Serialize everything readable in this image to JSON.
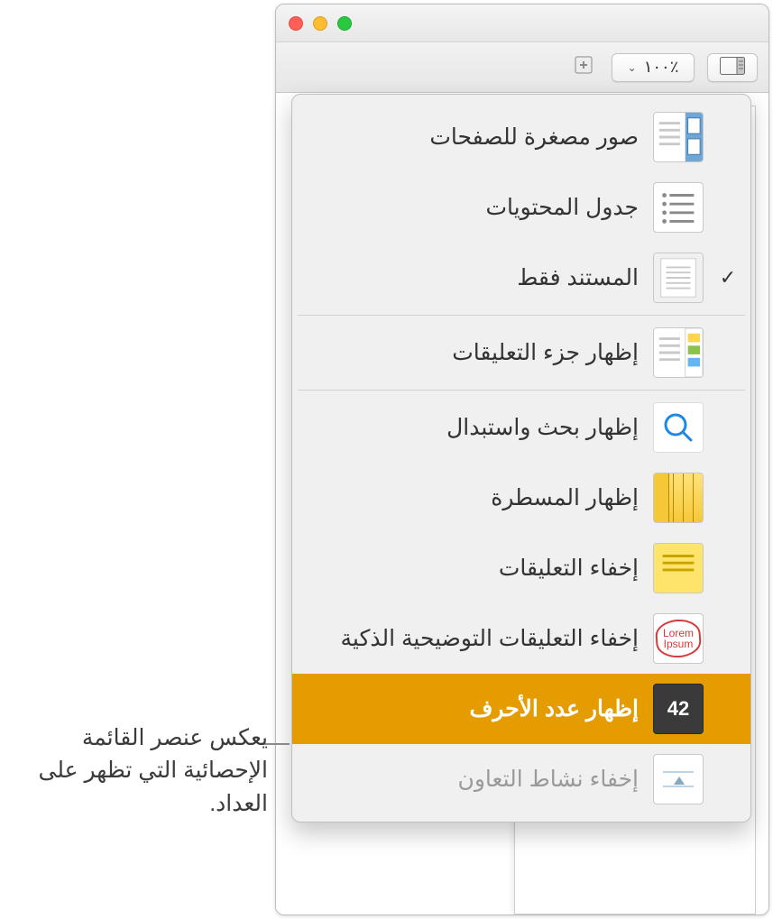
{
  "window": {
    "zoom_label": "٪١٠٠"
  },
  "menu": {
    "items": [
      {
        "id": "thumbnails",
        "label": "صور مصغرة للصفحات",
        "checked": false,
        "disabled": false
      },
      {
        "id": "toc",
        "label": "جدول المحتويات",
        "checked": false,
        "disabled": false
      },
      {
        "id": "doc-only",
        "label": "المستند فقط",
        "checked": true,
        "disabled": false
      },
      {
        "sep": true
      },
      {
        "id": "comments-pane",
        "label": "إظهار جزء التعليقات",
        "checked": false,
        "disabled": false
      },
      {
        "sep": true
      },
      {
        "id": "find",
        "label": "إظهار بحث واستبدال",
        "checked": false,
        "disabled": false
      },
      {
        "id": "ruler",
        "label": "إظهار المسطرة",
        "checked": false,
        "disabled": false
      },
      {
        "id": "hide-comments",
        "label": "إخفاء التعليقات",
        "checked": false,
        "disabled": false
      },
      {
        "id": "smart-annot",
        "label": "إخفاء التعليقات التوضيحية الذكية",
        "checked": false,
        "disabled": false
      },
      {
        "id": "char-count",
        "label": "إظهار عدد الأحرف",
        "checked": false,
        "disabled": false,
        "selected": true,
        "count_badge": "42"
      },
      {
        "id": "collab",
        "label": "إخفاء نشاط التعاون",
        "checked": false,
        "disabled": true
      }
    ]
  },
  "callout": {
    "text": "يعكس عنصر القائمة الإحصائية التي تظهر على العداد."
  }
}
